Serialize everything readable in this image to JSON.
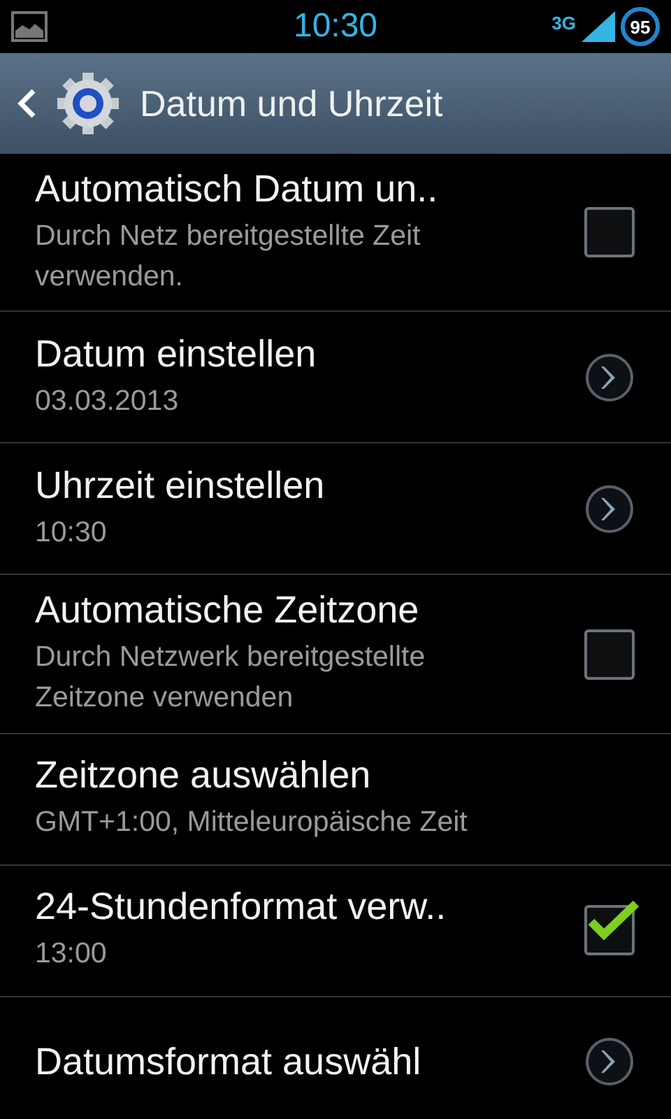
{
  "status_bar": {
    "time": "10:30",
    "network": "3G",
    "battery": "95"
  },
  "action_bar": {
    "title": "Datum und Uhrzeit"
  },
  "items": [
    {
      "kind": "checkbox",
      "title": "Automatisch Datum un..",
      "summary": "Durch Netz bereitgestellte Zeit verwenden.",
      "checked": false
    },
    {
      "kind": "chevron",
      "title": "Datum einstellen",
      "summary": "03.03.2013"
    },
    {
      "kind": "chevron",
      "title": "Uhrzeit einstellen",
      "summary": "10:30"
    },
    {
      "kind": "checkbox",
      "title": "Automatische Zeitzone",
      "summary": "Durch Netzwerk bereitgestellte Zeitzone verwenden",
      "checked": false
    },
    {
      "kind": "plain",
      "title": "Zeitzone auswählen",
      "summary": "GMT+1:00, Mitteleuropäische Zeit"
    },
    {
      "kind": "checkbox",
      "title": "24-Stundenformat verw..",
      "summary": "13:00",
      "checked": true
    },
    {
      "kind": "chevron",
      "title": "Datumsformat auswähl"
    }
  ]
}
